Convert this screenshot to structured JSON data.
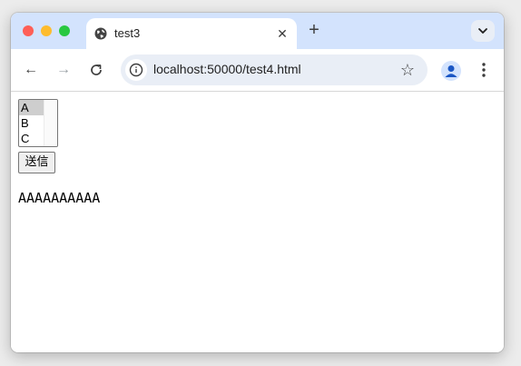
{
  "tab": {
    "title": "test3",
    "close": "✕"
  },
  "toolbar": {
    "new_tab": "+",
    "back": "←",
    "forward": "→",
    "url": "localhost:50000/test4.html",
    "bookmark": "☆"
  },
  "page": {
    "listbox_options": [
      "A",
      "B",
      "C"
    ],
    "selected": "A",
    "submit_label": "送信",
    "output_text": "AAAAAAAAAA"
  },
  "colors": {
    "tabstrip": "#d3e3fd",
    "omnibox": "#e9eef6",
    "profile_icon": "#1a56c4",
    "selected_option": "#cecece"
  }
}
